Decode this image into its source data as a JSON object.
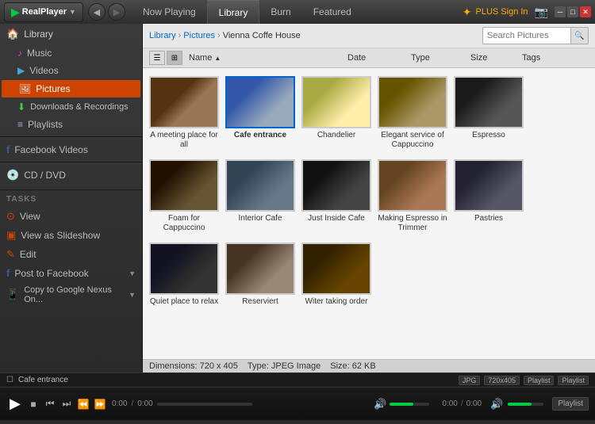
{
  "app": {
    "name": "RealPlayer",
    "logo": "▶"
  },
  "titlebar": {
    "tabs": [
      {
        "id": "now-playing",
        "label": "Now Playing",
        "active": false
      },
      {
        "id": "library",
        "label": "Library",
        "active": true
      },
      {
        "id": "burn",
        "label": "Burn",
        "active": false
      },
      {
        "id": "featured",
        "label": "Featured",
        "active": false
      }
    ],
    "plus_signin": "PLUS Sign In",
    "nav_back": "◀",
    "nav_forward": "▶"
  },
  "sidebar": {
    "library_label": "Library",
    "music_label": "Music",
    "videos_label": "Videos",
    "pictures_label": "Pictures",
    "downloads_label": "Downloads & Recordings",
    "playlists_label": "Playlists",
    "facebook_label": "Facebook Videos",
    "cd_dvd_label": "CD / DVD",
    "tasks_label": "TASKS",
    "view_label": "View",
    "slideshow_label": "View as Slideshow",
    "edit_label": "Edit",
    "post_label": "Post to Facebook",
    "copy_label": "Copy to Google Nexus On..."
  },
  "breadcrumb": {
    "library": "Library",
    "pictures": "Pictures",
    "current": "Vienna Coffe House"
  },
  "toolbar": {
    "search_placeholder": "Search Pictures",
    "list_view_icon": "☰",
    "grid_view_icon": "⊞"
  },
  "columns": {
    "name": "Name",
    "date": "Date",
    "type": "Type",
    "size": "Size",
    "tags": "Tags"
  },
  "thumbnails": [
    {
      "id": 1,
      "label": "A meeting place for all",
      "img_class": "img-1"
    },
    {
      "id": 2,
      "label": "Cafe entrance",
      "img_class": "img-2",
      "selected": true
    },
    {
      "id": 3,
      "label": "Chandelier",
      "img_class": "img-3"
    },
    {
      "id": 4,
      "label": "Elegant service of Cappuccino",
      "img_class": "img-4"
    },
    {
      "id": 5,
      "label": "Espresso",
      "img_class": "img-5"
    },
    {
      "id": 6,
      "label": "Foam for Cappuccino",
      "img_class": "img-6"
    },
    {
      "id": 7,
      "label": "Interior Cafe",
      "img_class": "img-7"
    },
    {
      "id": 8,
      "label": "Just Inside Cafe",
      "img_class": "img-8"
    },
    {
      "id": 9,
      "label": "Making Espresso in Trimmer",
      "img_class": "img-9"
    },
    {
      "id": 10,
      "label": "Pastries",
      "img_class": "img-10"
    },
    {
      "id": 11,
      "label": "Quiet place to relax",
      "img_class": "img-11"
    },
    {
      "id": 12,
      "label": "Reserviert",
      "img_class": "img-12"
    },
    {
      "id": 13,
      "label": "Witer taking order",
      "img_class": "img-13"
    }
  ],
  "status": {
    "dimensions": "Dimensions: 720 x 405",
    "type": "Type: JPEG Image",
    "size": "Size: 62 KB"
  },
  "player": {
    "track": "Cafe entrance",
    "time_current": "0:00",
    "time_total": "0:00",
    "playlist_label": "Playlist",
    "format_badge": "JPG",
    "res_badge": "720x405"
  },
  "bottom_bar": {
    "track_name": "Cafe entrance",
    "format": "JPG",
    "resolution": "720x405",
    "playlist": "Playlist"
  }
}
